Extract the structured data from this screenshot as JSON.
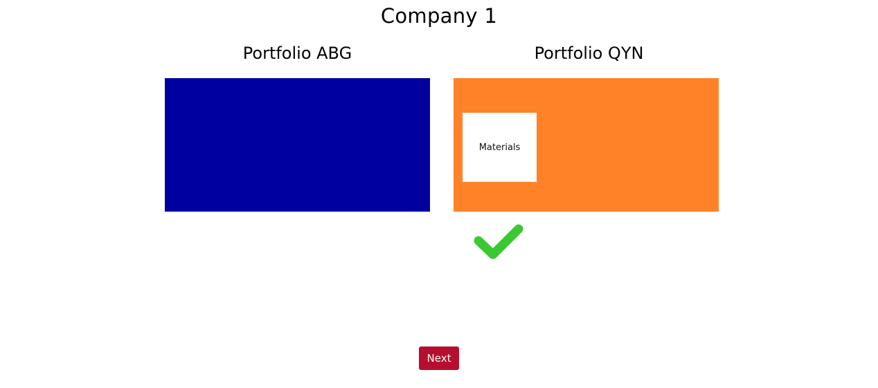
{
  "header": {
    "title": "Company 1"
  },
  "portfolios": [
    {
      "title": "Portfolio ABG",
      "color": "#0000a0",
      "card": null
    },
    {
      "title": "Portfolio QYN",
      "color": "#ff8228",
      "card": {
        "label": "Materials"
      }
    }
  ],
  "feedback": {
    "icon": "checkmark-icon",
    "color": "#3cc832"
  },
  "actions": {
    "next_label": "Next",
    "next_color": "#b50f2d"
  }
}
